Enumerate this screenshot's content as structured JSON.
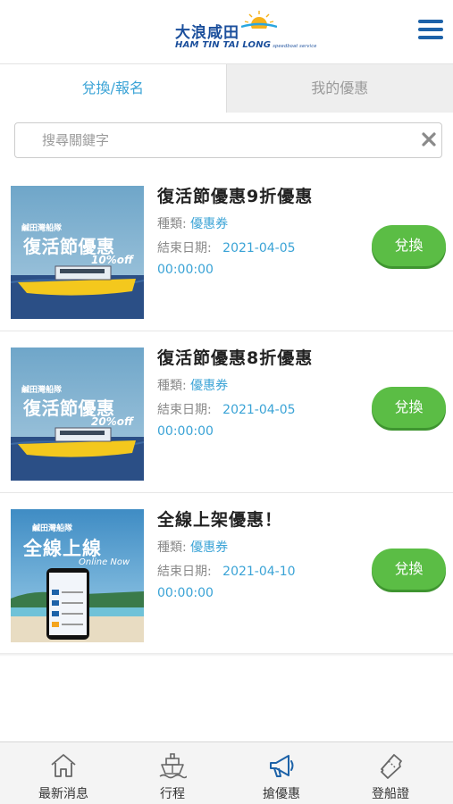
{
  "header": {
    "logo_cn": "大浪咸田",
    "logo_en": "HAM TIN TAI LONG",
    "logo_sub": "speedboat service",
    "menu_icon": "hamburger-menu-icon"
  },
  "tabs": [
    {
      "label": "兌換/報名",
      "active": true
    },
    {
      "label": "我的優惠",
      "active": false
    }
  ],
  "search": {
    "placeholder": "搜尋關鍵字",
    "value": "",
    "clear_icon": "clear-icon"
  },
  "offers": [
    {
      "title": "復活節優惠9折優惠",
      "type_label": "種類:",
      "type_value": "優惠券",
      "end_label": "結束日期:",
      "end_date": "2021-04-05",
      "end_time": "00:00:00",
      "button": "兌換",
      "thumb": {
        "brand": "鹹田灣船隊",
        "headline": "復活節優惠",
        "tag": "10%off"
      }
    },
    {
      "title": "復活節優惠8折優惠",
      "type_label": "種類:",
      "type_value": "優惠券",
      "end_label": "結束日期:",
      "end_date": "2021-04-05",
      "end_time": "00:00:00",
      "button": "兌換",
      "thumb": {
        "brand": "鹹田灣船隊",
        "headline": "復活節優惠",
        "tag": "20%off"
      }
    },
    {
      "title": "全線上架優惠！",
      "type_label": "種類:",
      "type_value": "優惠券",
      "end_label": "結束日期:",
      "end_date": "2021-04-10",
      "end_time": "00:00:00",
      "button": "兌換",
      "thumb": {
        "brand": "鹹田灣船隊",
        "headline": "全線上線",
        "tag": "Online Now"
      }
    }
  ],
  "bottom_nav": [
    {
      "label": "最新消息",
      "icon": "home-icon",
      "active": false
    },
    {
      "label": "行程",
      "icon": "ship-icon",
      "active": false
    },
    {
      "label": "搶優惠",
      "icon": "megaphone-icon",
      "active": true
    },
    {
      "label": "登船證",
      "icon": "ticket-icon",
      "active": false
    }
  ],
  "colors": {
    "accent": "#3aa3d6",
    "button_green": "#5bbd45",
    "brand_blue": "#1b4f9c"
  }
}
